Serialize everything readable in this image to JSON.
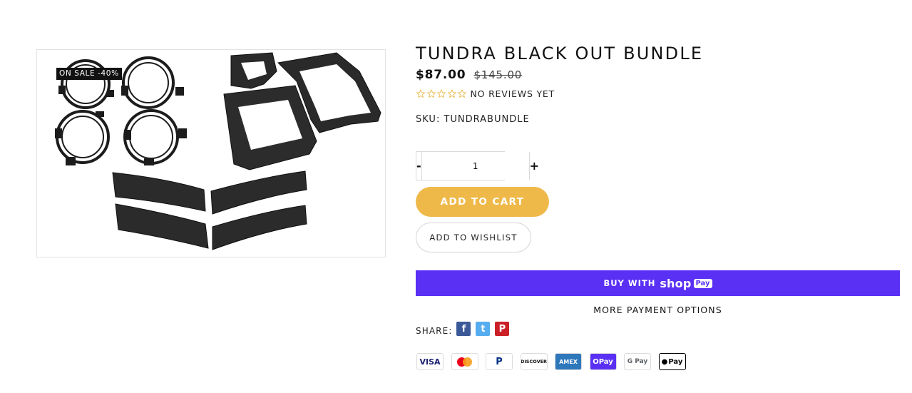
{
  "product": {
    "badge": "ON SALE -40%",
    "title": "TUNDRA BLACK OUT BUNDLE",
    "price": "$87.00",
    "compare_price": "$145.00",
    "rating": 0,
    "reviews_text": "NO REVIEWS YET",
    "sku": "SKU: TUNDRABUNDLE"
  },
  "quantity": {
    "minus_label": "-",
    "value": "1",
    "plus_label": "+"
  },
  "actions": {
    "add_to_cart": "ADD TO CART",
    "add_to_wishlist": "ADD TO WISHLIST",
    "buy_with": "BUY WITH",
    "shop_word": "shop",
    "pay_word": "Pay",
    "more_payment_options": "MORE PAYMENT OPTIONS"
  },
  "share": {
    "label": "SHARE:",
    "networks": [
      {
        "name": "facebook",
        "glyph": "f",
        "color": "#3b5998"
      },
      {
        "name": "twitter",
        "glyph": "t",
        "color": "#55acee"
      },
      {
        "name": "pinterest",
        "glyph": "P",
        "color": "#cb2027"
      }
    ]
  },
  "payment_methods": [
    {
      "name": "visa",
      "label": "VISA"
    },
    {
      "name": "mastercard",
      "label": ""
    },
    {
      "name": "paypal",
      "label": "P"
    },
    {
      "name": "discover",
      "label": "DISCOVER"
    },
    {
      "name": "amex",
      "label": "AMEX"
    },
    {
      "name": "shop-pay",
      "label": "OPay"
    },
    {
      "name": "google-pay",
      "label": "G Pay"
    },
    {
      "name": "apple-pay",
      "label": "Pay"
    }
  ],
  "colors": {
    "accent_cart": "#efb94a",
    "shop_pay": "#5a31f4",
    "star_outline": "#e8b94a"
  }
}
